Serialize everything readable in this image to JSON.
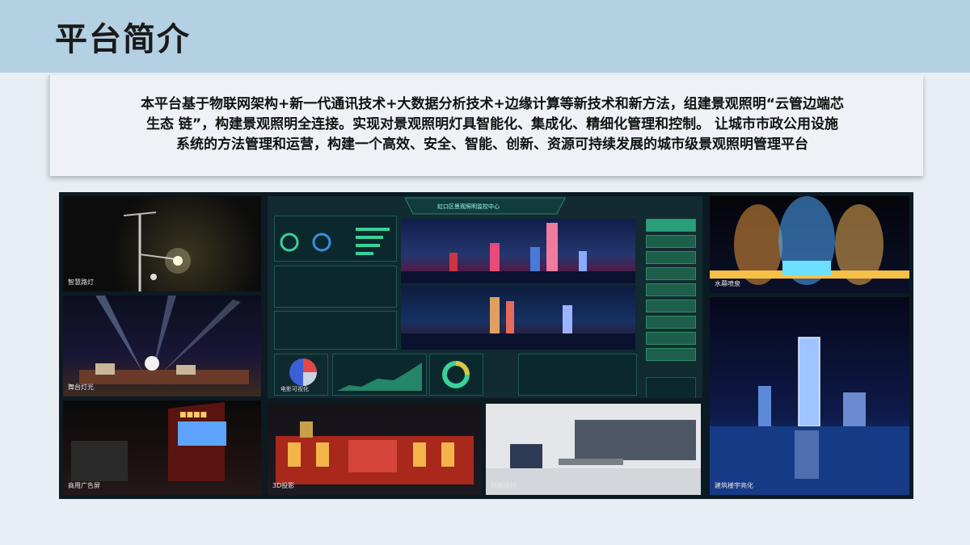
{
  "header": {
    "title": "平台简介"
  },
  "intro": {
    "line1": "本平台基于物联网架构+新一代通讯技术+大数据分析技术+边缘计算等新技术和新方法，组建景观照明“云管边端芯",
    "line2": "生态 链”，构建景观照明全连接。实现对景观照明灯具智能化、集成化、精细化管理和控制。 让城市市政公用设施",
    "line3": "系统的方法管理和运营，构建一个高效、安全、智能、创新、资源可持续发展的城市级景观照明管理平台"
  },
  "collage": {
    "dashboard_title": "虹口区景观照明监控中心",
    "captions": {
      "street_light": "智慧路灯",
      "stage_light": "舞台灯光",
      "billboard": "商用广告屏",
      "projection": "3D投影",
      "monitoring": "视频监控",
      "fountain": "水幕喷泉",
      "building": "建筑楼宇亮化",
      "pie": "电影可视化"
    }
  },
  "colors": {
    "header_bg": "#b4d0e3",
    "intro_bg": "#eef2f6",
    "accent_green": "#3bd19a"
  }
}
